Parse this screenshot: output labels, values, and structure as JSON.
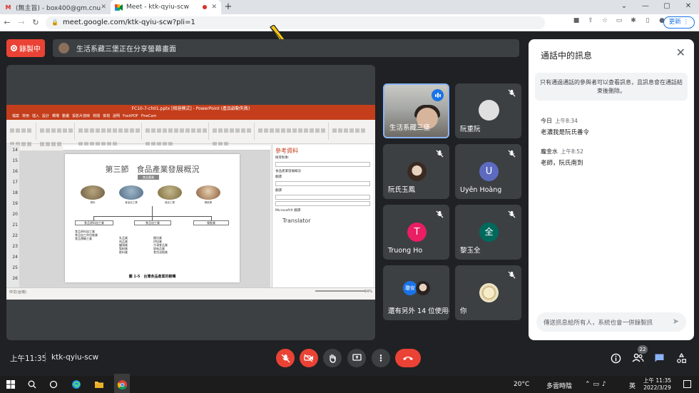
{
  "browser": {
    "tabs": [
      {
        "favicon": "gmail-icon",
        "title": "(無主旨) - box400@gm.cnu.edu"
      },
      {
        "favicon": "meet-icon",
        "title": "Meet - ktk-qyiu-scw"
      }
    ],
    "url": "meet.google.com/ktk-qyiu-scw?pli=1",
    "update_label": "更新"
  },
  "meet": {
    "recording_label": "錄製中",
    "share_banner": "生活系藏三堡正在分享螢幕畫面",
    "meeting_time": "上午11:35",
    "meeting_code": "ktk-qyiu-scw",
    "participants_count": "22",
    "accent_red": "#ea4335",
    "accent_blue": "#1a73e8"
  },
  "presentation": {
    "window_title": "FC10-7-ch01.pptx [相容模式] - PowerPoint (產品啟動失敗)",
    "slide_numbers": [
      "14",
      "15",
      "16",
      "17",
      "18",
      "19",
      "20",
      "21",
      "22",
      "23",
      "24",
      "25",
      "26"
    ],
    "slide_title": "第三節　食品產業發展概況",
    "slide_tag": "食品產業",
    "slide_captions": [
      "原料",
      "食品加工業",
      "食品工業",
      "餐飲業"
    ],
    "slide_boxes": [
      "食品原料加工業",
      "食品加工業",
      "餐飲業"
    ],
    "slide_sub_left": "食品原料加工業\n食品加工與包裝業\n食品運輸工業",
    "slide_sub_mid": "乳品業\n肉品業\n罐頭業\n製粉業\n飲料業",
    "slide_sub_right": "麵包業\n烘焙業\n冷凍食品業\n調味品業\n食用油脂業",
    "slide_figure_caption": "圖 1-5　台灣食品產業的範疇",
    "pane_title": "參考資料",
    "pane_rows": [
      "搜尋對象:",
      "食品產業發展概況",
      "翻譯",
      "翻譯",
      "Microsoft® 翻譯"
    ],
    "pane_translator": "Translator",
    "status_text": "中文(台灣)",
    "zoom": "64%"
  },
  "participants": [
    {
      "name": "生活系藏三堡",
      "type": "video",
      "speaking": true
    },
    {
      "name": "阮重阮",
      "type": "avatar-image",
      "avatar_color": "#e0e0e0",
      "muted": true
    },
    {
      "name": "阮氏玉鳳",
      "type": "avatar-image",
      "avatar_color": "#cfcfcf",
      "muted": true
    },
    {
      "name": "Uyên Hoàng",
      "type": "avatar",
      "initial": "U",
      "avatar_color": "#5c6bc0",
      "muted": true
    },
    {
      "name": "Truong Ho",
      "type": "avatar",
      "initial": "T",
      "avatar_color": "#e91e63",
      "muted": true
    },
    {
      "name": "黎玉全",
      "type": "avatar",
      "initial": "全",
      "avatar_color": "#00695c",
      "muted": true
    },
    {
      "name": "還有另外 14 位使用者",
      "type": "more",
      "muted": false
    },
    {
      "name": "你",
      "type": "avatar-image",
      "avatar_color": "#efe6c6",
      "muted": true
    }
  ],
  "chat": {
    "title": "通話中的訊息",
    "notice": "只有通過通話的參與者可以查看訊息，且訊息會在通話結束後刪除。",
    "messages": [
      {
        "sender": "今日",
        "time": "上午8:34",
        "text": "老濃我是阮氏番令"
      },
      {
        "sender": "龐金水",
        "time": "上午8:52",
        "text": "老師，阮氏南到"
      }
    ],
    "input_placeholder": "傳送訊息給所有人，系統也會一併錄製訊"
  },
  "taskbar": {
    "weather": "20°C",
    "condition": "多雲時陰",
    "ime": "英",
    "clock_time": "上午 11:35",
    "clock_date": "2022/3/29"
  }
}
